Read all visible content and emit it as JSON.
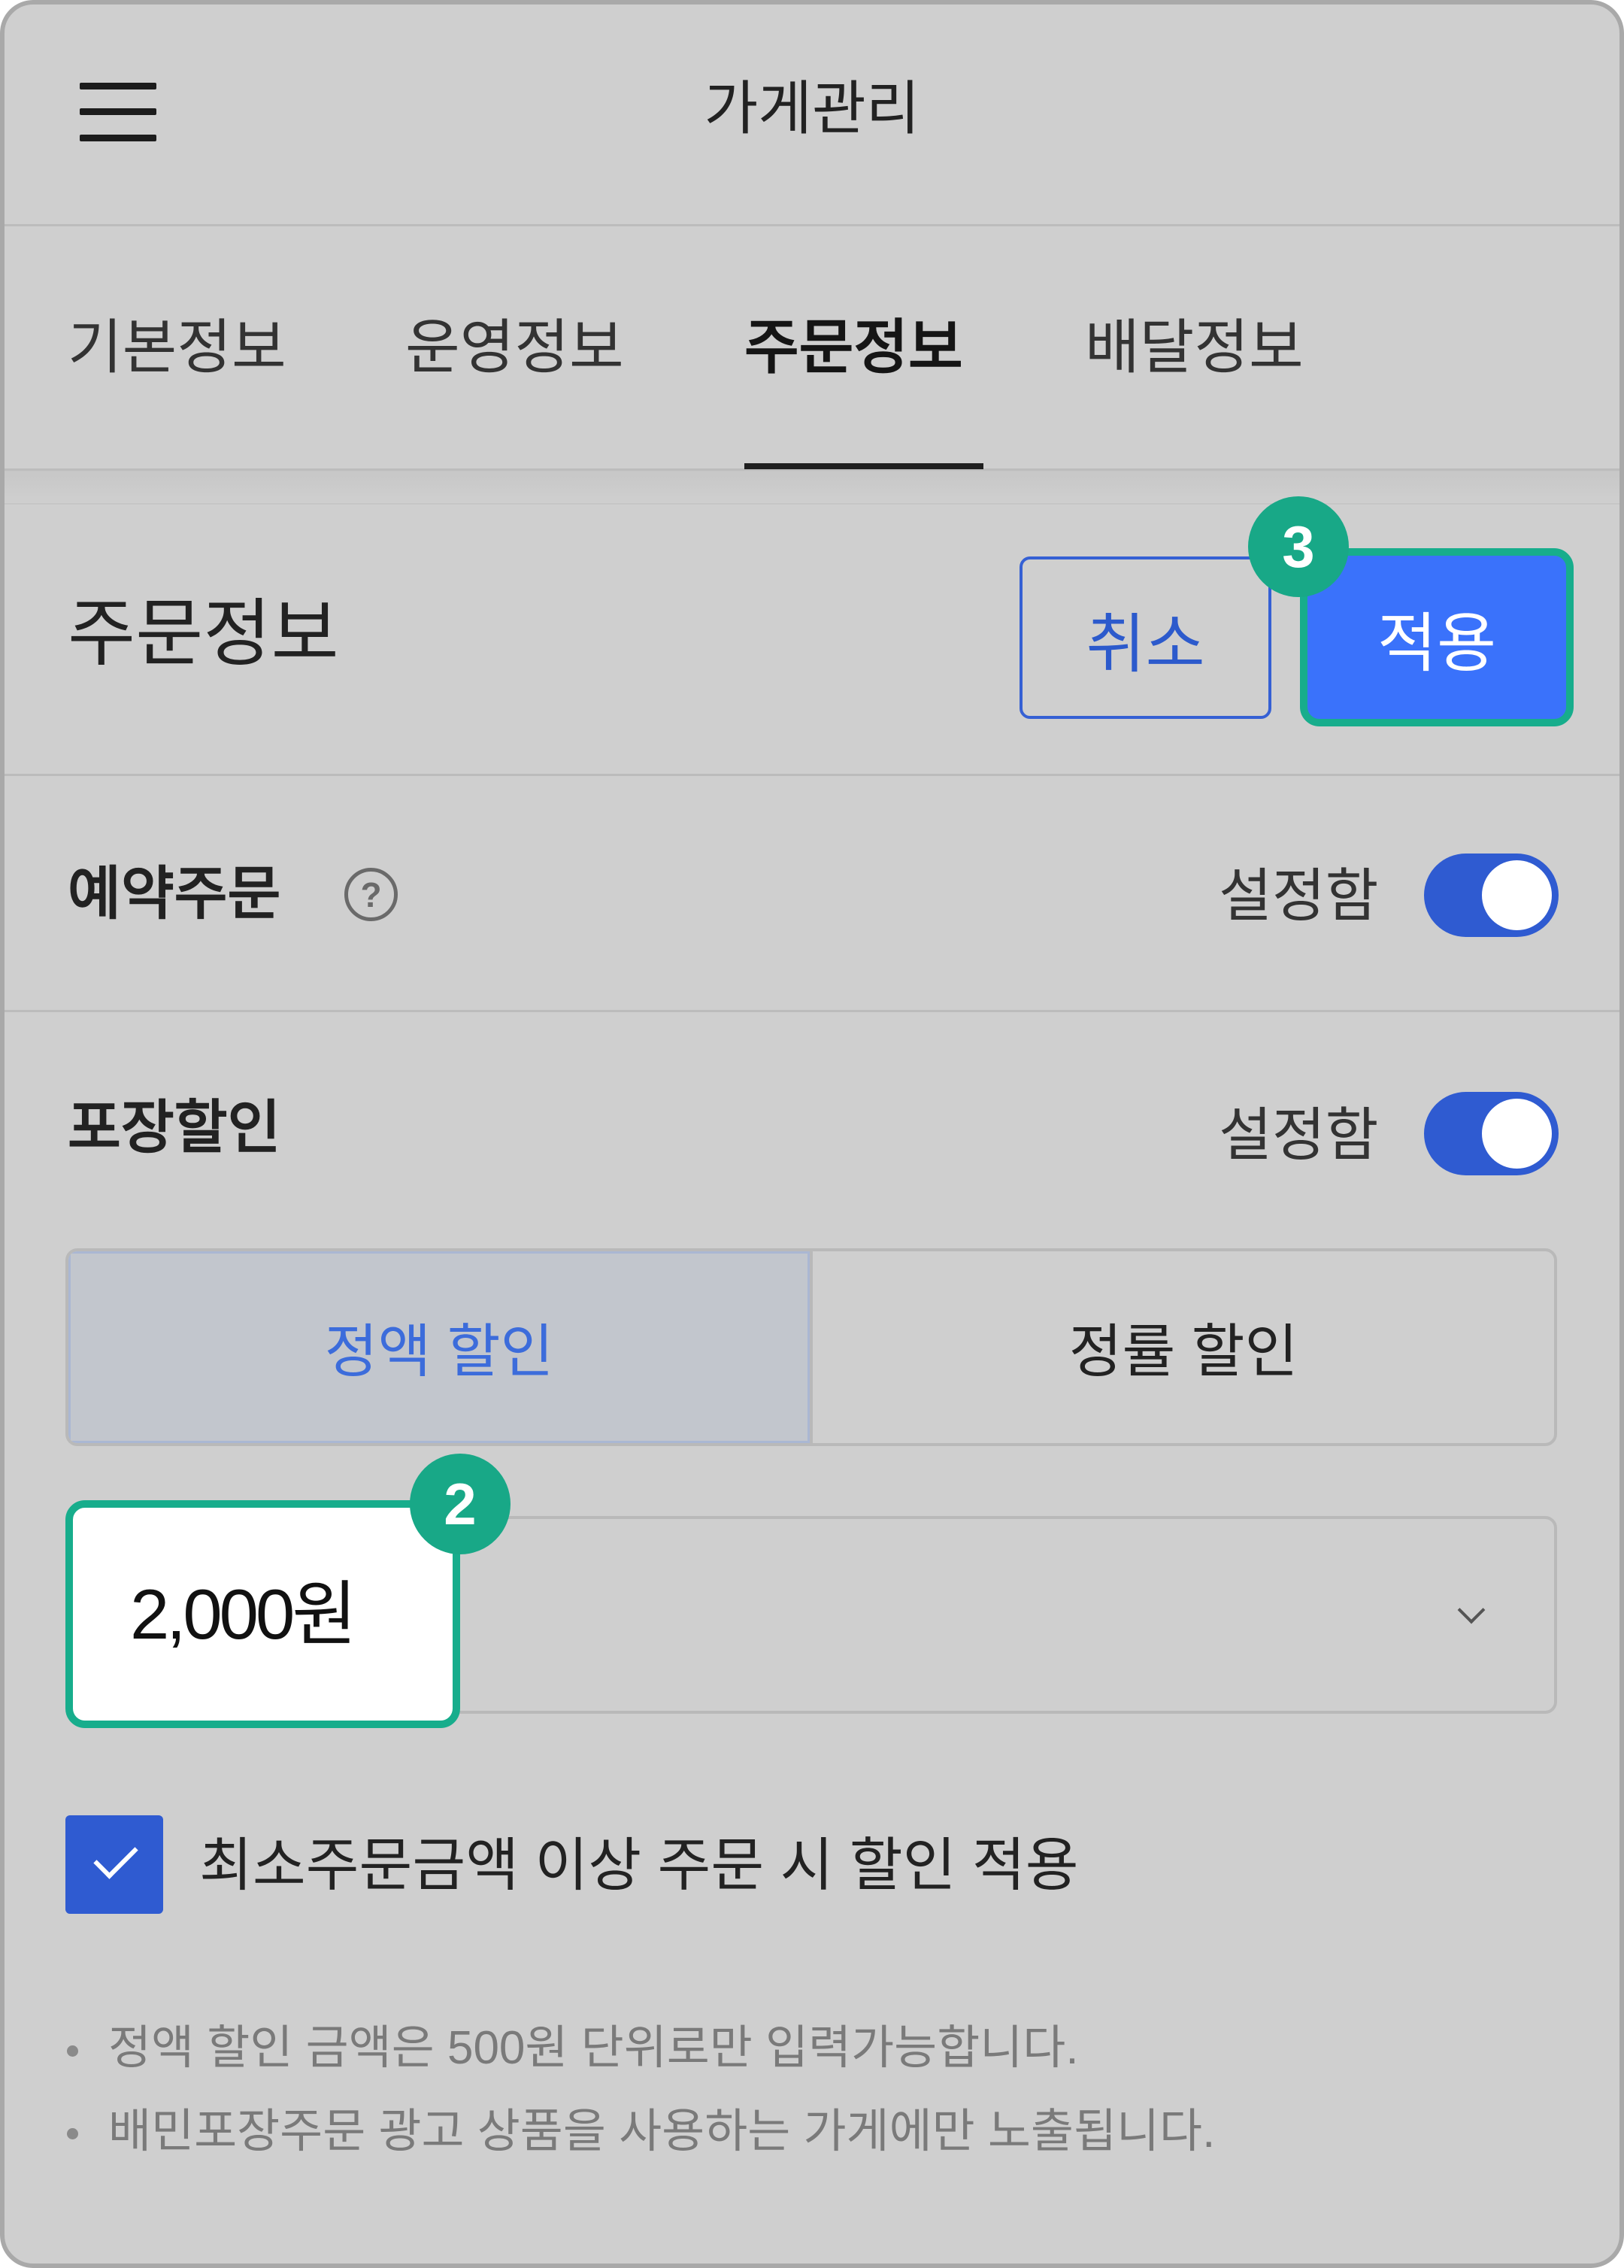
{
  "header": {
    "title": "가게관리",
    "menu_icon": "hamburger-icon"
  },
  "tabs": [
    {
      "label": "기본정보",
      "active": false
    },
    {
      "label": "운영정보",
      "active": false
    },
    {
      "label": "주문정보",
      "active": true
    },
    {
      "label": "배달정보",
      "active": false
    }
  ],
  "section": {
    "title": "주문정보",
    "cancel_label": "취소",
    "apply_label": "적용",
    "apply_step_badge": "3"
  },
  "reservation_order": {
    "label": "예약주문",
    "help_icon": "question-circle-icon",
    "status_label": "설정함",
    "enabled": true
  },
  "pickup_discount": {
    "label": "포장할인",
    "status_label": "설정함",
    "enabled": true,
    "discount_types": [
      {
        "label": "정액 할인",
        "selected": true
      },
      {
        "label": "정률 할인",
        "selected": false
      }
    ],
    "amount": {
      "value": "2,000원",
      "step_badge": "2",
      "dropdown_icon": "chevron-down-icon"
    },
    "min_order_option": {
      "label": "최소주문금액 이상 주문 시 할인 적용",
      "checked": true,
      "icon": "check-icon"
    }
  },
  "notes": [
    "정액 할인 금액은 500원 단위로만 입력가능합니다.",
    "배민포장주문 광고 상품을 사용하는 가게에만 노출됩니다."
  ],
  "colors": {
    "background": "#cfcfcf",
    "primary_blue": "#3a72fb",
    "toggle_blue": "#2f5bd1",
    "outline_blue": "#3560d4",
    "highlight_teal": "#17ad8c",
    "text_primary": "#222222",
    "text_muted": "#7a7a7a",
    "segment_selected_bg": "#c2c6cd",
    "segment_selected_text": "#3c6cdb"
  }
}
